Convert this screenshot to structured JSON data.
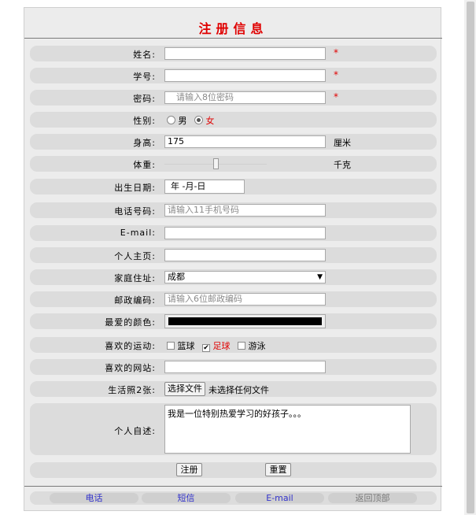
{
  "title": "注册信息",
  "fields": {
    "name": {
      "label": "姓名:",
      "value": "",
      "required_mark": "*"
    },
    "student_id": {
      "label": "学号:",
      "value": "",
      "required_mark": "*"
    },
    "password": {
      "label": "密码:",
      "placeholder": "请输入8位密码",
      "required_mark": "*"
    },
    "gender": {
      "label": "性别:",
      "options": [
        "男",
        "女"
      ],
      "selected": "女"
    },
    "height": {
      "label": "身高:",
      "value": "175",
      "unit": "厘米"
    },
    "weight": {
      "label": "体重:",
      "unit": "千克",
      "slider_fraction": 0.5
    },
    "birthdate": {
      "label": "出生日期:",
      "value": "年 -月-日"
    },
    "phone": {
      "label": "电话号码:",
      "placeholder": "请输入11手机号码"
    },
    "email": {
      "label": "E-mail:",
      "value": ""
    },
    "homepage": {
      "label": "个人主页:",
      "value": ""
    },
    "address": {
      "label": "家庭住址:",
      "selected": "成都"
    },
    "postcode": {
      "label": "邮政编码:",
      "placeholder": "请输入6位邮政编码"
    },
    "color": {
      "label": "最爱的颜色:",
      "value": "#000000"
    },
    "sports": {
      "label": "喜欢的运动:",
      "options": [
        {
          "text": "篮球",
          "checked": false
        },
        {
          "text": "足球",
          "checked": true
        },
        {
          "text": "游泳",
          "checked": false
        }
      ]
    },
    "website": {
      "label": "喜欢的网站:",
      "value": ""
    },
    "photo": {
      "label": "生活照2张:",
      "button": "选择文件",
      "status": "未选择任何文件"
    },
    "bio": {
      "label": "个人自述:",
      "value": "我是一位特别热爱学习的好孩子。。。"
    }
  },
  "buttons": {
    "submit": "注册",
    "reset": "重置"
  },
  "footer": [
    "电话",
    "短信",
    "E-mail",
    "返回顶部"
  ],
  "colors": {
    "accent": "#e00000",
    "link": "#3333cc",
    "row_bg": "#dcdcdc"
  }
}
